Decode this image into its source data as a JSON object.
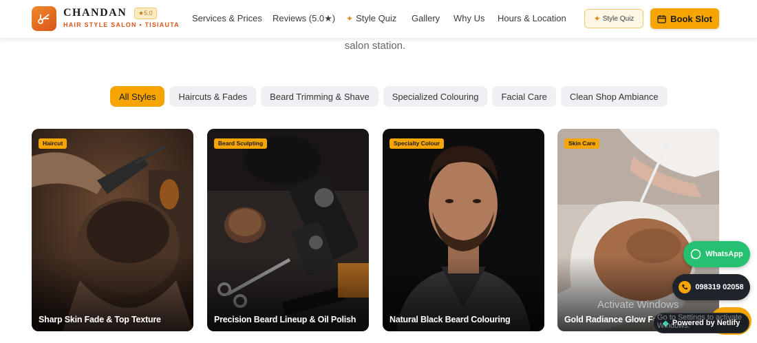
{
  "brand": {
    "name": "CHANDAN",
    "rating": "★5.0",
    "subtitle": "HAIR STYLE SALON • TISIAUTA"
  },
  "nav": {
    "services": "Services & Prices",
    "reviews": "Reviews (5.0★)",
    "quiz": "Style Quiz",
    "gallery": "Gallery",
    "why": "Why Us",
    "hours": "Hours & Location"
  },
  "buttons": {
    "style_quiz": "Style Quiz",
    "book_slot": "Book Slot"
  },
  "hero": {
    "subtitle_tail": "salon station."
  },
  "filters": [
    "All Styles",
    "Haircuts & Fades",
    "Beard Trimming & Shave",
    "Specialized Colouring",
    "Facial Care",
    "Clean Shop Ambiance"
  ],
  "cards": [
    {
      "tag": "Haircut",
      "title": "Sharp Skin Fade & Top Texture"
    },
    {
      "tag": "Beard Sculpting",
      "title": "Precision Beard Lineup & Oil Polish"
    },
    {
      "tag": "Specialty Colour",
      "title": "Natural Black Beard Colouring"
    },
    {
      "tag": "Skin Care",
      "title": "Gold Radiance Glow Facial"
    }
  ],
  "floating": {
    "whatsapp": "WhatsApp",
    "phone": "098319 02058",
    "netlify": "Powered by Netlify",
    "watermark": "Activate Windows",
    "watermark_sub": "Go to Settings to activate Windows."
  },
  "colors": {
    "accent": "#f6a400",
    "brand_orange": "#d9541a",
    "whatsapp": "#25c070"
  }
}
